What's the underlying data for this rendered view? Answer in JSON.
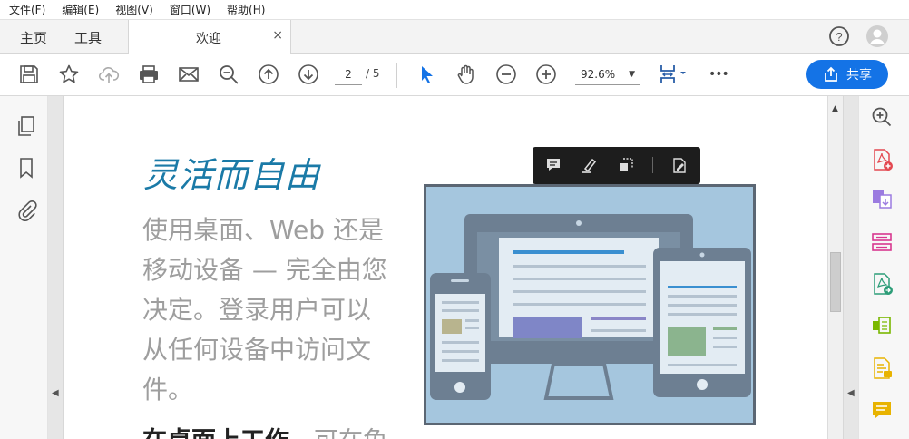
{
  "menu": {
    "file": "文件(F)",
    "edit": "编辑(E)",
    "view": "视图(V)",
    "window": "窗口(W)",
    "help": "帮助(H)"
  },
  "tabs": {
    "home": "主页",
    "tools": "工具",
    "document": "欢迎",
    "close": "×"
  },
  "toolbar": {
    "page_current": "2",
    "page_total": "/ 5",
    "zoom": "92.6%",
    "share_label": "共享",
    "more": "•••"
  },
  "document": {
    "heading": "灵活而自由",
    "body_lines": [
      "使用桌面、Web 还是",
      "移动设备 — 完全由您",
      "决定。登录用户可以",
      "从任何设备中访问文",
      "件。"
    ],
    "bottom_bold": "在桌面上工作。",
    "bottom_rest": "可在免"
  },
  "colors": {
    "accent": "#1473e6",
    "heading": "#1a7aa7",
    "float_bar": "#1d1d1d"
  }
}
